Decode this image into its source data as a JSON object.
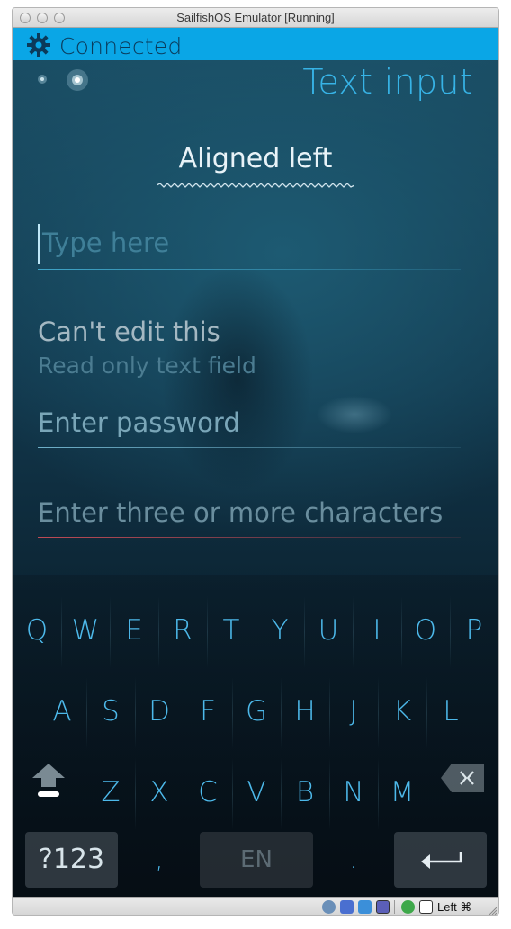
{
  "window": {
    "title": "SailfishOS Emulator [Running]"
  },
  "statusbar": {
    "connection_text": "Connected",
    "gear_icon": "gear-icon",
    "color": "#0aa6e6"
  },
  "page": {
    "header": "Text input"
  },
  "combo": {
    "value": "Aligned left"
  },
  "fields": {
    "type_here": {
      "placeholder": "Type here",
      "value": ""
    },
    "readonly": {
      "value": "Can't edit this",
      "description": "Read only text field"
    },
    "password": {
      "placeholder": "Enter password"
    },
    "min_chars": {
      "placeholder": "Enter three or more characters",
      "error_color": "#c04a55"
    }
  },
  "keyboard": {
    "row1": [
      "Q",
      "W",
      "E",
      "R",
      "T",
      "Y",
      "U",
      "I",
      "O",
      "P"
    ],
    "row2": [
      "A",
      "S",
      "D",
      "F",
      "G",
      "H",
      "J",
      "K",
      "L"
    ],
    "row3": [
      "Z",
      "X",
      "C",
      "V",
      "B",
      "N",
      "M"
    ],
    "symbols_label": "?123",
    "comma": ",",
    "language_label": "EN",
    "period": ".",
    "shift_icon": "shift-arrow-icon",
    "backspace_icon": "backspace-icon",
    "enter_icon": "enter-arrow-icon",
    "accent_color": "#4db9ea"
  },
  "host_statusbar": {
    "host_key_text": "Left ⌘"
  }
}
